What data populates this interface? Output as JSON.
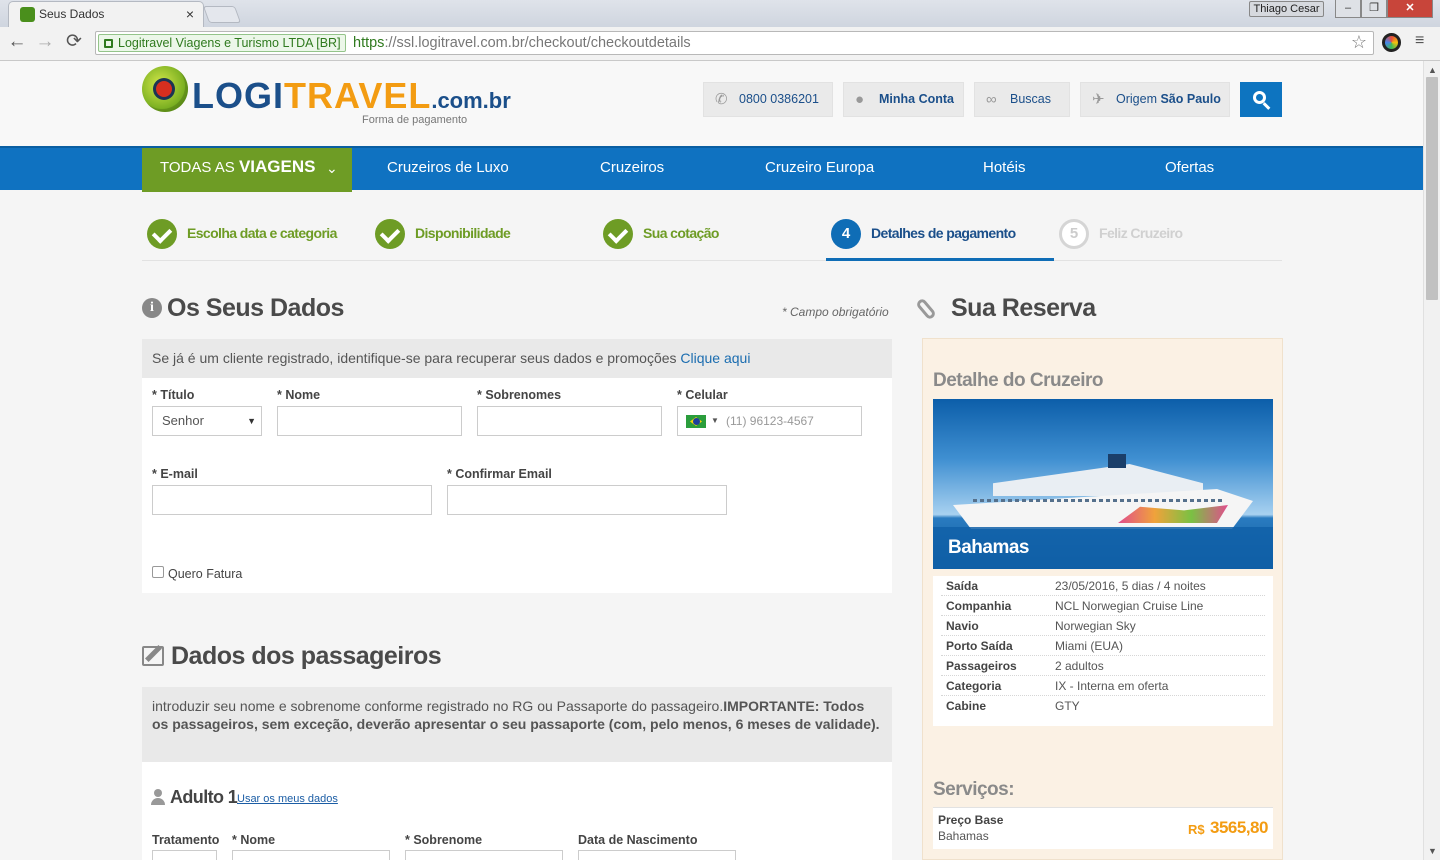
{
  "browser": {
    "tab_title": "Seus Dados",
    "tab_close": "×",
    "window_user": "Thiago Cesar",
    "window_min": "‒",
    "window_max": "❐",
    "window_close": "✕",
    "cert_owner": "Logitravel Viagens e Turismo LTDA [BR]",
    "url_proto": "https",
    "url_rest": "://ssl.logitravel.com.br/checkout/checkoutdetails",
    "back": "←",
    "forward": "→",
    "reload": "⟳",
    "star": "☆",
    "menu": "≡"
  },
  "header": {
    "logo_part1": "LOGI",
    "logo_part2": "TRAVEL",
    "logo_part3": ".com.br",
    "logo_sub": "Forma de pagamento",
    "phone": "0800 0386201",
    "account": "Minha Conta",
    "searches": "Buscas",
    "origin_label": "Origem",
    "origin_city": "São Paulo",
    "icons": {
      "phone": "phone-icon",
      "account": "user-icon",
      "searches": "binoculars-icon",
      "origin": "airplane-icon",
      "search": "search-icon"
    }
  },
  "nav": {
    "all_prefix": "TODAS AS",
    "all_bold": "VIAGENS",
    "all_chevron": "⌄",
    "items": [
      "Cruzeiros de Luxo",
      "Cruzeiros",
      "Cruzeiro Europa",
      "Hotéis",
      "Ofertas"
    ]
  },
  "steps": [
    {
      "label": "Escolha data e categoria",
      "state": "done"
    },
    {
      "label": "Disponibilidade",
      "state": "done"
    },
    {
      "label": "Sua cotação",
      "state": "done"
    },
    {
      "number": "4",
      "label": "Detalhes de pagamento",
      "state": "current"
    },
    {
      "number": "5",
      "label": "Feliz Cruzeiro",
      "state": "pending"
    }
  ],
  "form": {
    "title": "Os Seus Dados",
    "info_glyph": "i",
    "required_note": "* Campo obrigatório",
    "login_text": "Se já é um cliente registrado, identifique-se para recuperar seus dados e promoções",
    "login_link": "Clique aqui",
    "titulo_label": "* Título",
    "titulo_value": "Senhor",
    "nome_label": "* Nome",
    "sobrenomes_label": "* Sobrenomes",
    "celular_label": "* Celular",
    "celular_placeholder": "(11) 96123-4567",
    "email_label": "* E-mail",
    "confirm_email_label": "* Confirmar Email",
    "fatura_label": "Quero Fatura"
  },
  "passengers": {
    "title": "Dados dos passageiros",
    "note_text": "introduzir seu nome e sobrenome conforme registrado no RG ou Passaporte do passageiro.",
    "note_bold": "IMPORTANTE: Todos os passageiros, sem exceção, deverão apresentar o seu passaporte (com, pelo menos, 6 meses de validade).",
    "adult_title": "Adulto 1",
    "use_my_data": "Usar os meus dados",
    "tratamento_label": "Tratamento",
    "nome_label": "* Nome",
    "sobrenome_label": "* Sobrenome",
    "nascimento_label": "Data de Nascimento"
  },
  "reservation": {
    "title": "Sua Reserva",
    "detail_title": "Detalhe do Cruzeiro",
    "destination": "Bahamas",
    "details": [
      {
        "k": "Saída",
        "v": "23/05/2016, 5 dias / 4 noites"
      },
      {
        "k": "Companhia",
        "v": "NCL Norwegian Cruise Line"
      },
      {
        "k": "Navio",
        "v": "Norwegian Sky"
      },
      {
        "k": "Porto Saída",
        "v": "Miami (EUA)"
      },
      {
        "k": "Passageiros",
        "v": "2 adultos"
      },
      {
        "k": "Categoria",
        "v": "IX - Interna em oferta"
      },
      {
        "k": "Cabine",
        "v": "GTY"
      }
    ],
    "services_title": "Serviços:",
    "base_price_label": "Preço Base",
    "base_price_desc": "Bahamas",
    "currency": "R$",
    "base_price": "3565,80"
  },
  "colors": {
    "brand_blue": "#0f72c1",
    "brand_green": "#6e9c25",
    "price_orange": "#f39c12"
  }
}
